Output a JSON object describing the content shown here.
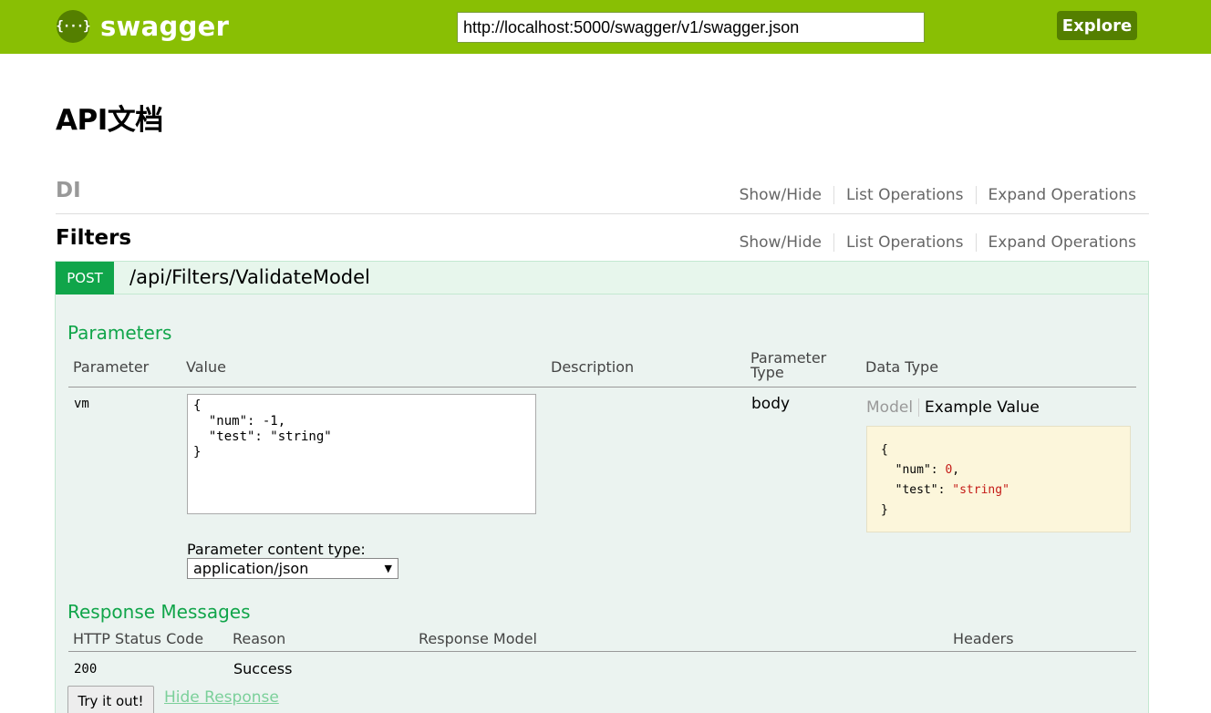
{
  "header": {
    "logo_icon": "{···}",
    "logo_text": "swagger",
    "url_value": "http://localhost:5000/swagger/v1/swagger.json",
    "explore_label": "Explore",
    "background_color": "#89bf04"
  },
  "page_title": "API文档",
  "resources": [
    {
      "name": "DI",
      "show_hide": "Show/Hide",
      "list_operations": "List Operations",
      "expand_operations": "Expand Operations"
    },
    {
      "name": "Filters",
      "show_hide": "Show/Hide",
      "list_operations": "List Operations",
      "expand_operations": "Expand Operations"
    }
  ],
  "operation": {
    "method": "POST",
    "path": "/api/Filters/ValidateModel",
    "method_color": "#10a54a",
    "parameters": {
      "title": "Parameters",
      "columns": {
        "parameter": "Parameter",
        "value": "Value",
        "description": "Description",
        "parameter_type": "Parameter\nType",
        "data_type": "Data Type"
      },
      "rows": [
        {
          "name": "vm",
          "value": "{\n  \"num\": -1,\n  \"test\": \"string\"\n}",
          "type": "body",
          "model_tab": "Model",
          "example_tab": "Example Value",
          "example": {
            "open": "{",
            "num_key": "\"num\"",
            "num_val": "0",
            "test_key": "\"test\"",
            "test_val": "\"string\"",
            "close": "}"
          }
        }
      ],
      "content_type_label": "Parameter content type:",
      "content_type_value": "application/json"
    },
    "responses": {
      "title": "Response Messages",
      "columns": {
        "status": "HTTP Status Code",
        "reason": "Reason",
        "model": "Response Model",
        "headers": "Headers"
      },
      "rows": [
        {
          "status": "200",
          "reason": "Success"
        }
      ]
    },
    "try_label": "Try it out!",
    "hide_label": "Hide Response"
  }
}
